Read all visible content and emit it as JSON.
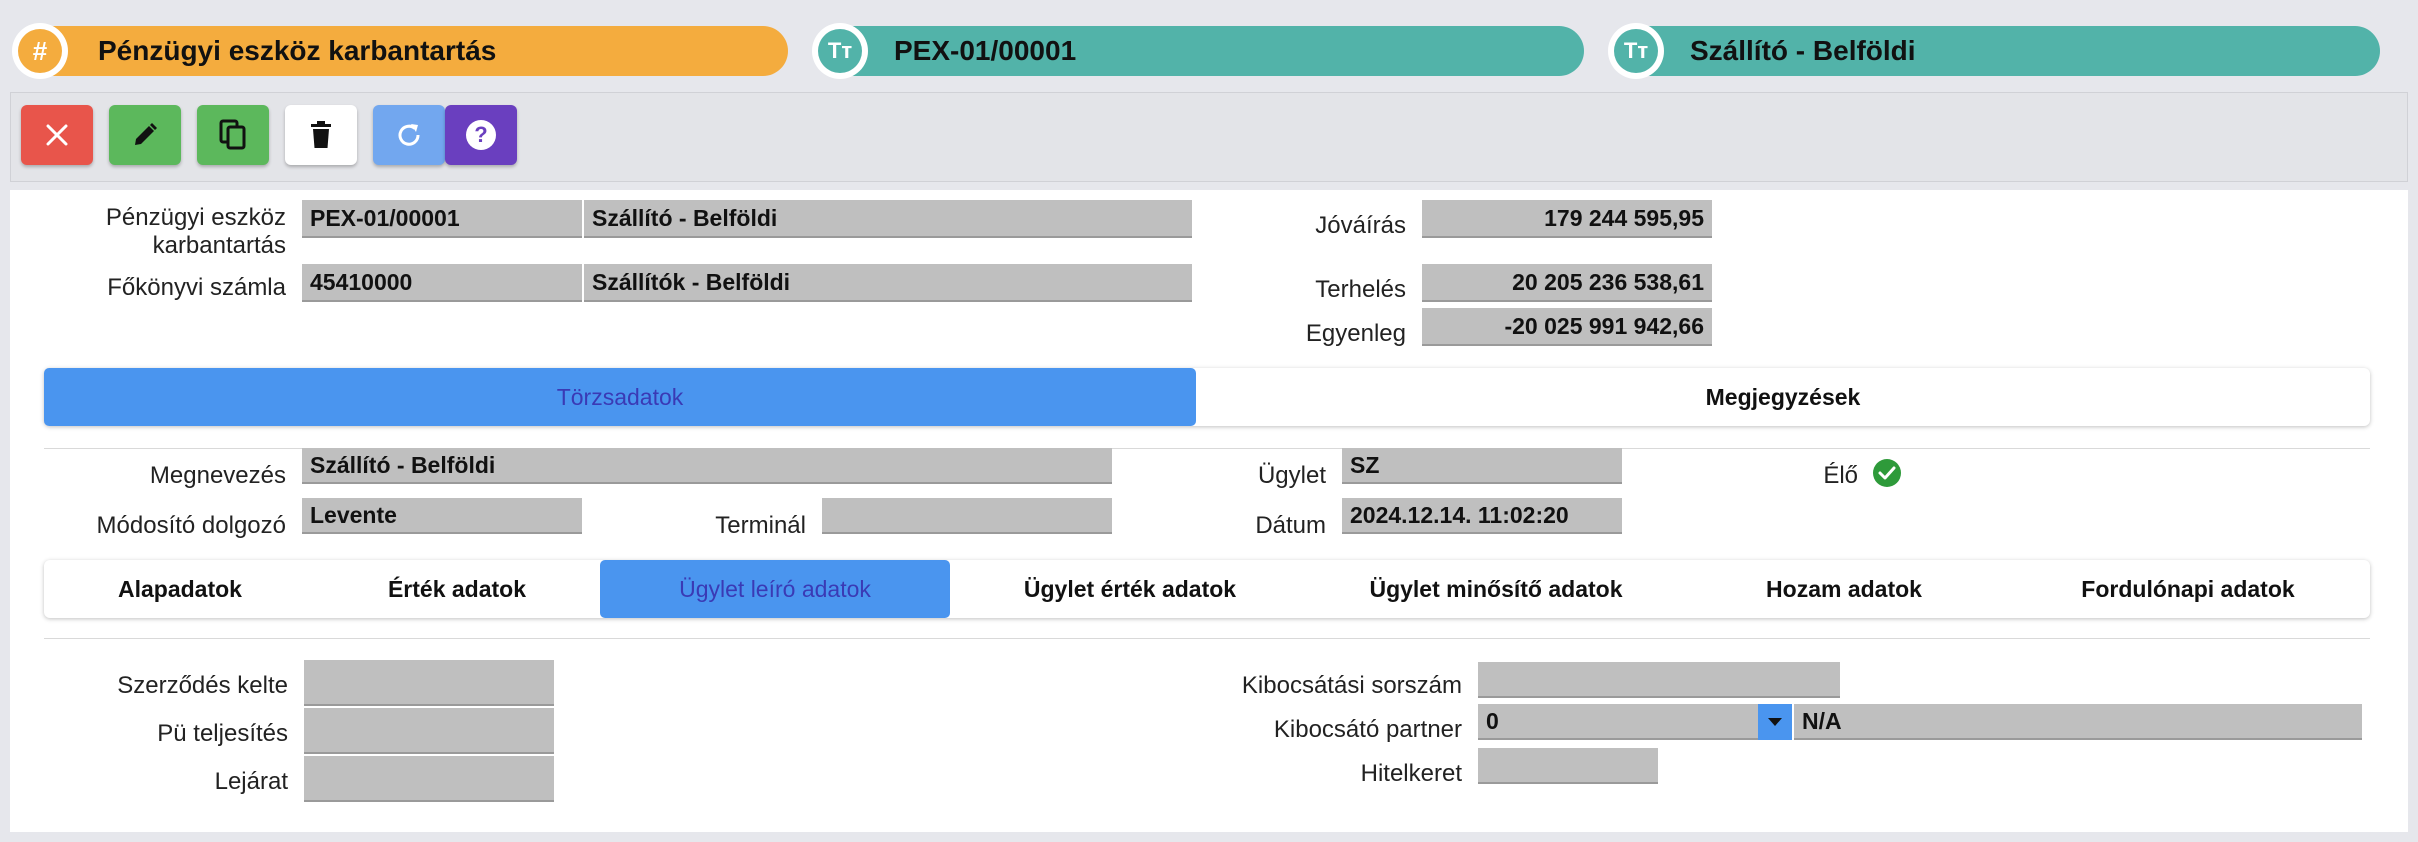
{
  "header": {
    "title_pill": {
      "icon": "hash-icon",
      "text": "Pénzügyi eszköz karbantartás",
      "color": "#f4ac3e"
    },
    "code_pill": {
      "icon": "text-type-icon",
      "text": "PEX-01/00001",
      "color": "#52b3a9"
    },
    "name_pill": {
      "icon": "text-type-icon",
      "text": "Szállító - Belföldi",
      "color": "#52b3a9"
    }
  },
  "toolbar": {
    "buttons": [
      {
        "name": "close-button",
        "icon": "close-icon",
        "color": "#e8554b"
      },
      {
        "name": "edit-button",
        "icon": "pencil-icon",
        "color": "#5cb85c"
      },
      {
        "name": "copy-button",
        "icon": "copy-icon",
        "color": "#5cb85c"
      },
      {
        "name": "delete-button",
        "icon": "trash-icon",
        "color": "#ffffff"
      },
      {
        "name": "refresh-button",
        "icon": "refresh-icon",
        "color": "#72a7ef"
      },
      {
        "name": "help-button",
        "icon": "question-icon",
        "color": "#6a3fbf"
      }
    ]
  },
  "summary": {
    "asset_label_line1": "Pénzügyi eszköz",
    "asset_label_line2": "karbantartás",
    "asset_code": "PEX-01/00001",
    "asset_name": "Szállító - Belföldi",
    "ledger_label": "Főkönyvi számla",
    "ledger_code": "45410000",
    "ledger_name": "Szállítók - Belföldi",
    "credit_label": "Jóváírás",
    "credit_value": "179 244 595,95",
    "debit_label": "Terhelés",
    "debit_value": "20 205 236 538,61",
    "balance_label": "Egyenleg",
    "balance_value": "-20 025 991 942,66"
  },
  "main_tabs": [
    {
      "label": "Törzsadatok",
      "active": true
    },
    {
      "label": "Megjegyzések",
      "active": false
    }
  ],
  "master": {
    "name_label": "Megnevezés",
    "name_value": "Szállító - Belföldi",
    "modifier_label": "Módosító dolgozó",
    "modifier_value": "Levente",
    "terminal_label": "Terminál",
    "terminal_value": "",
    "deal_label": "Ügylet",
    "deal_value": "SZ",
    "date_label": "Dátum",
    "date_value": "2024.12.14. 11:02:20",
    "alive_label": "Élő",
    "alive_icon": "check-circle-icon"
  },
  "sub_tabs": [
    {
      "label": "Alapadatok",
      "active": false
    },
    {
      "label": "Érték adatok",
      "active": false
    },
    {
      "label": "Ügylet leíró adatok",
      "active": true
    },
    {
      "label": "Ügylet érték adatok",
      "active": false
    },
    {
      "label": "Ügylet minősítő adatok",
      "active": false
    },
    {
      "label": "Hozam adatok",
      "active": false
    },
    {
      "label": "Fordulónapi adatok",
      "active": false
    }
  ],
  "details": {
    "contract_date_label": "Szerződés kelte",
    "contract_date_value": "",
    "fulfillment_label": "Pü teljesítés",
    "fulfillment_value": "",
    "maturity_label": "Lejárat",
    "maturity_value": "",
    "issue_serial_label": "Kibocsátási sorszám",
    "issue_serial_value": "",
    "issuer_partner_label": "Kibocsátó partner",
    "issuer_partner_code": "0",
    "issuer_partner_name": "N/A",
    "credit_line_label": "Hitelkeret",
    "credit_line_value": ""
  }
}
